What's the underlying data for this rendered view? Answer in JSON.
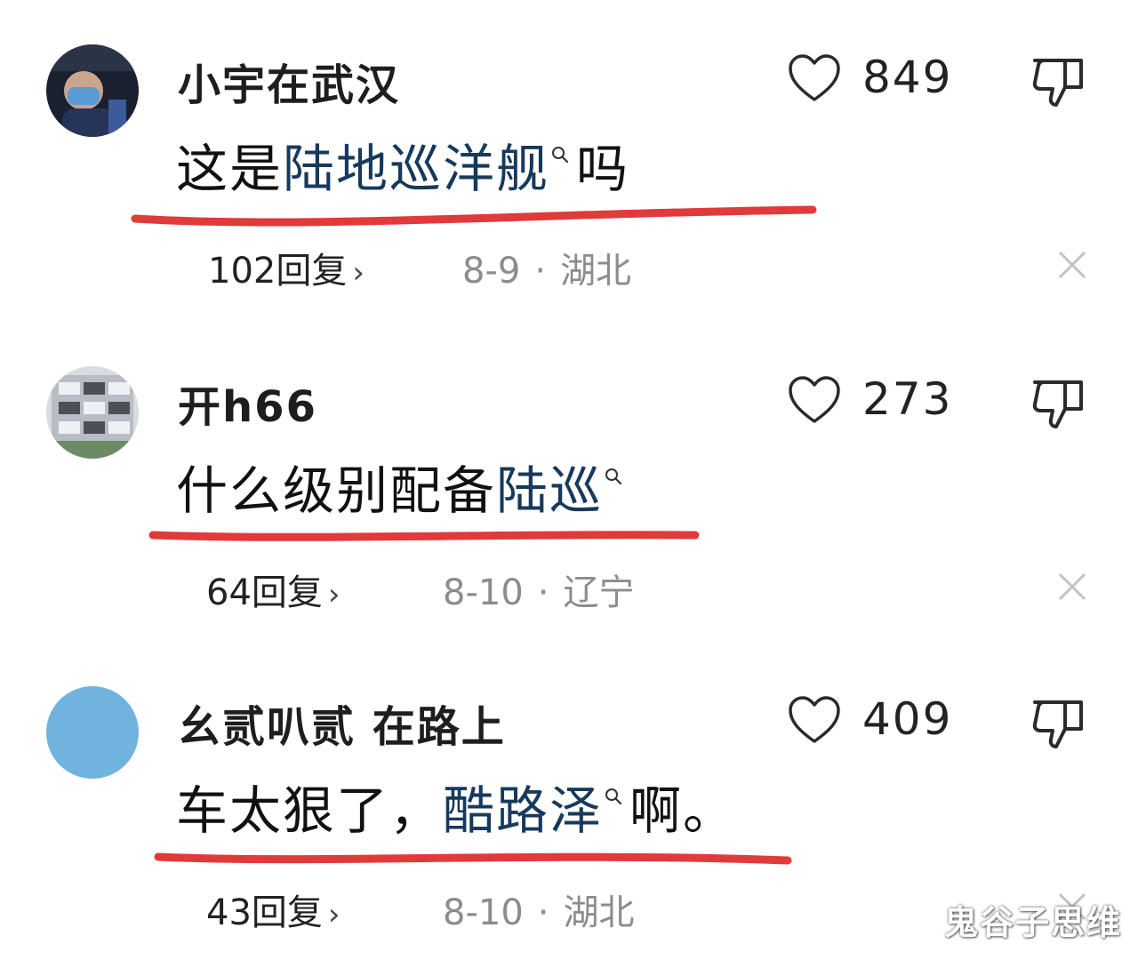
{
  "colors": {
    "underline": "#e03a3a",
    "keyword": "#17395c",
    "meta_gray": "#8c8c8c"
  },
  "comments": [
    {
      "username": "小宇在武汉",
      "text_before": "这是",
      "keyword": "陆地巡洋舰",
      "text_after": "吗",
      "likes": "849",
      "replies": "102回复",
      "date": "8-9",
      "location": "湖北"
    },
    {
      "username": "开h66",
      "text_before": "什么级别配备",
      "keyword": "陆巡",
      "text_after": "",
      "likes": "273",
      "replies": "64回复",
      "date": "8-10",
      "location": "辽宁"
    },
    {
      "username": "幺贰叭贰 在路上",
      "text_before": "车太狠了，",
      "keyword": "酷路泽",
      "text_after": "啊。",
      "likes": "409",
      "replies": "43回复",
      "date": "8-10",
      "location": "湖北"
    }
  ],
  "meta_separator": "·",
  "chevron": "›",
  "watermark": "鬼谷子思维",
  "icons": {
    "like": "heart-outline-icon",
    "dislike": "thumbs-down-icon",
    "close": "close-icon",
    "search": "search-icon"
  }
}
